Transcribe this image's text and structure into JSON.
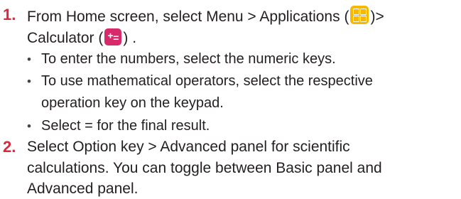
{
  "steps": [
    {
      "number": "1.",
      "line1_before": "From Home screen, select Menu > Applications (",
      "line1_after": ")>",
      "line2_before": "Calculator (",
      "line2_after": ") .",
      "apps_icon": "applications-grid-icon",
      "calc_icon": "calculator-icon",
      "bullets": [
        "To enter the numbers, select the numeric keys.",
        "To use mathematical operators, select the respective",
        "operation key on the keypad.",
        "Select = for the final result."
      ]
    },
    {
      "number": "2.",
      "lines": [
        "Select Option key > Advanced panel for scientific",
        "calculations. You can toggle between Basic panel and",
        "Advanced panel."
      ]
    }
  ],
  "colors": {
    "step_number": "#d6293e",
    "apps_icon": "#f7b800",
    "calc_icon": "#d62a6b",
    "text": "#231f20"
  }
}
